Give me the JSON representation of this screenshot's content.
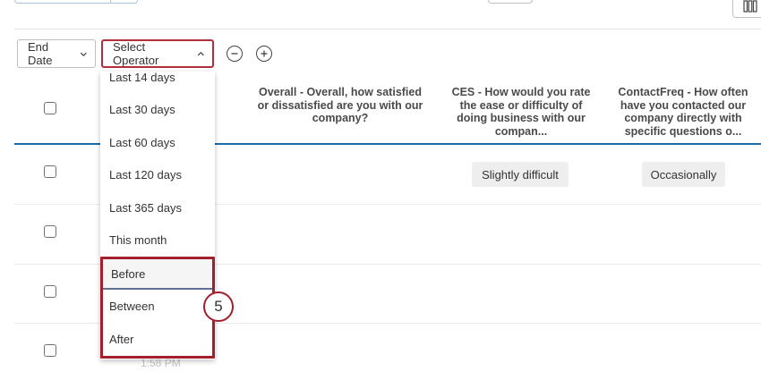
{
  "toolbar": {
    "end_date_label": "End Date",
    "select_operator_label": "Select Operator"
  },
  "table": {
    "columns": [
      "Overall - Overall, how satisfied or dissatisfied are you with our company?",
      "CES - How would you rate the ease or difficulty of doing business with our compan...",
      "ContactFreq - How often have you contacted our company directly with specific questions o..."
    ],
    "row1": {
      "ces": "Slightly difficult",
      "contact_freq": "Occasionally"
    },
    "faded_time": "1:58 PM"
  },
  "dropdown": {
    "items": [
      "Last 14 days",
      "Last 30 days",
      "Last 60 days",
      "Last 120 days",
      "Last 365 days",
      "This month",
      "Before",
      "Between",
      "After"
    ]
  },
  "annotation": {
    "step_number": "5",
    "accent_color": "#a31f2e"
  },
  "colors": {
    "header_underline": "#1a6aa6",
    "focus_border": "#5e6f94"
  }
}
